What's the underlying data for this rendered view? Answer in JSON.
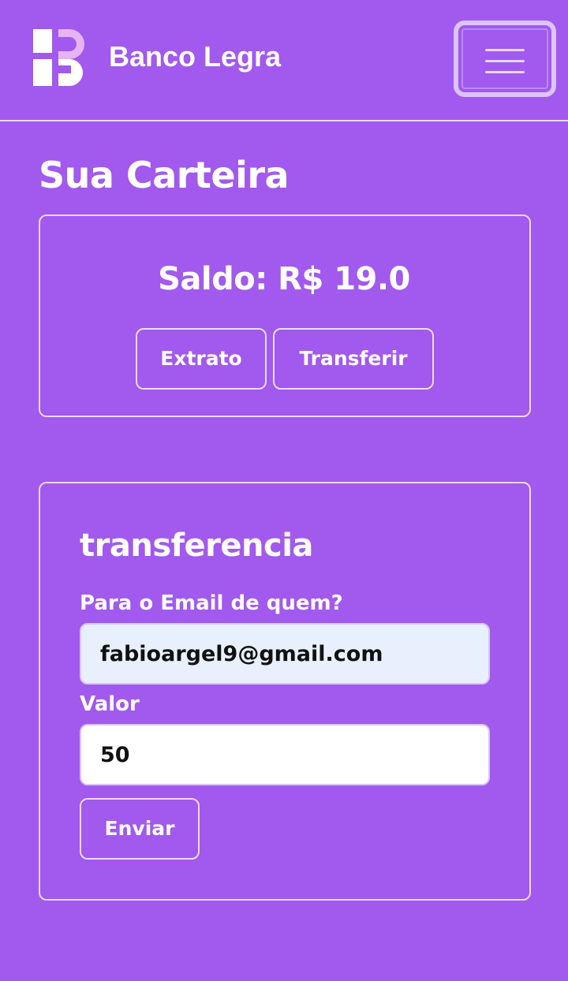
{
  "navbar": {
    "brand": "Banco Legra",
    "logo_icon": "bank-logo-icon",
    "menu_icon": "hamburger-menu-icon"
  },
  "wallet": {
    "title": "Sua Carteira",
    "balance_text": "Saldo: R$ 19.0",
    "statement_label": "Extrato",
    "transfer_label": "Transferir"
  },
  "transfer_form": {
    "title": "transferencia",
    "email_label": "Para o Email de quem?",
    "email_value": "fabioargel9@gmail.com",
    "amount_label": "Valor",
    "amount_value": "50",
    "submit_label": "Enviar"
  },
  "colors": {
    "background": "#a259ee",
    "border": "#e8d9fb",
    "logo_accent": "#e6b4f2",
    "autofill_background": "#e8f0fe"
  }
}
